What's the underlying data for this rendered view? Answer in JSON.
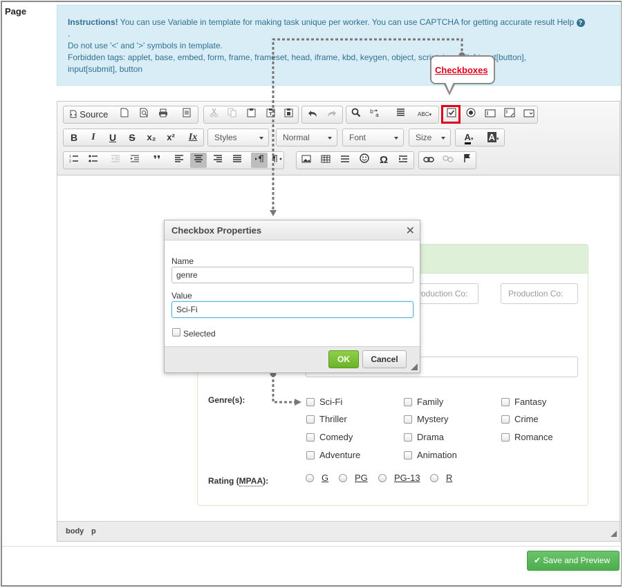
{
  "page_label": "Page",
  "instructions": {
    "title": "Instructions!",
    "line1": " You can use Variable in template for making task unique per worker. You can use CAPTCHA for getting accurate result Help",
    "dot": ".",
    "line2": "Do not use '<' and '>' symbols in template.",
    "line3": "Forbidden tags: applet, base, embed, form, frame, frameset, head, iframe, kbd, keygen, object, script, input[file],input[button],",
    "line4": "input[submit], button",
    "help_icon": "?"
  },
  "toolbar": {
    "source_label": "Source",
    "styles_label": "Styles",
    "format_label": "Normal",
    "font_label": "Font",
    "size_label": "Size",
    "bold": "B",
    "italic": "I",
    "underline": "U",
    "strike": "S",
    "subscript": "x₂",
    "superscript": "x²",
    "remove_format": "Ix",
    "blockquote": "❜❜",
    "text_color": "A",
    "bg_color": "A",
    "omega": "Ω",
    "spell": "ABC"
  },
  "callout": {
    "label": "Checkboxes"
  },
  "statusbar": {
    "body": "body",
    "p": "p"
  },
  "dialog": {
    "title": "Checkbox Properties",
    "close": "✕",
    "name_label": "Name",
    "name_value": "genre",
    "value_label": "Value",
    "value_value": "Sci-Fi",
    "selected_label": "Selected",
    "ok_label": "OK",
    "cancel_label": "Cancel"
  },
  "form": {
    "production_placeholder_1": "Production Co:",
    "production_placeholder_2": "Production Co:",
    "genre_label": "Genre(s):",
    "genres": [
      "Sci-Fi",
      "Family",
      "Fantasy",
      "Thriller",
      "Mystery",
      "Crime",
      "Comedy",
      "Drama",
      "Romance",
      "Adventure",
      "Animation"
    ],
    "rating_label": "Rating (",
    "rating_abbr": "MPAA",
    "rating_label_end": "):",
    "ratings": [
      "G",
      "PG",
      "PG-13",
      "R"
    ]
  },
  "save_button": {
    "label": "Save and Preview",
    "icon": "✔"
  },
  "colors": {
    "accent_red": "#e0001b",
    "ok_green": "#6ab328",
    "save_green": "#4cae4c",
    "info_bg": "#d9edf7",
    "info_text": "#31708f"
  }
}
